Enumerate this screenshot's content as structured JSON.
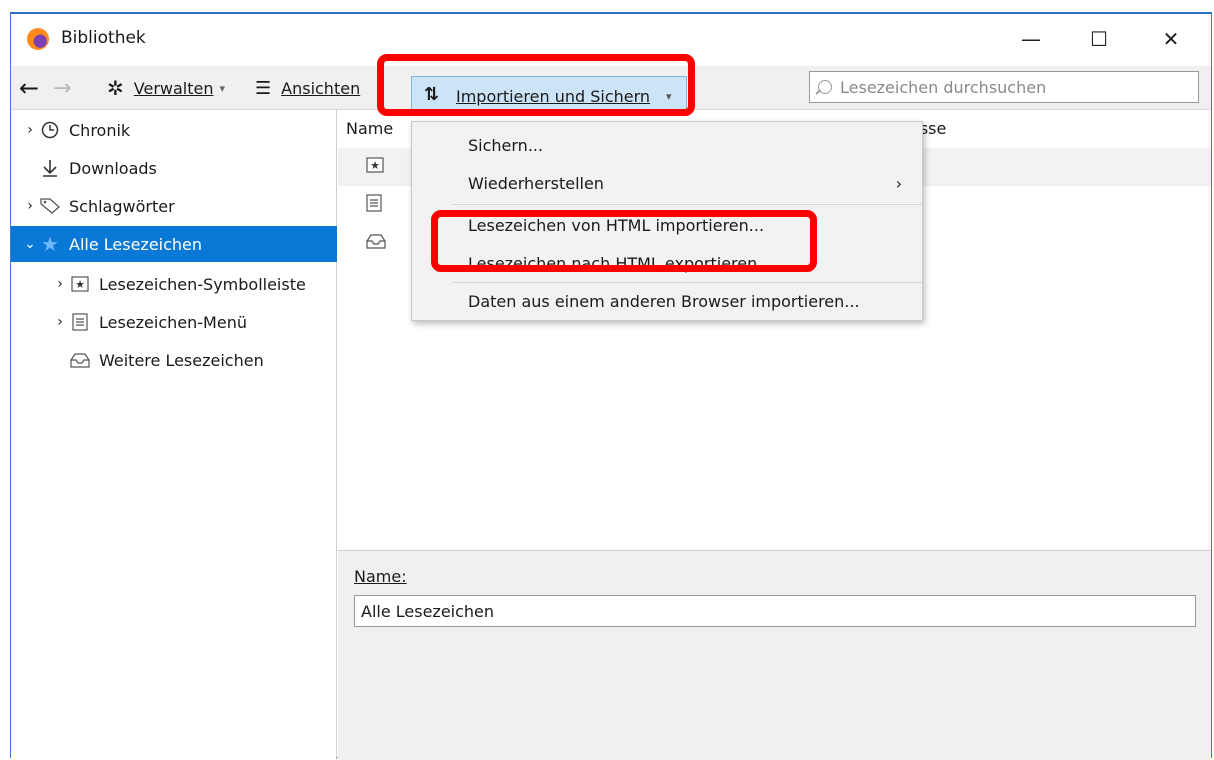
{
  "window": {
    "title": "Bibliothek",
    "buttons": {
      "minimize": "—",
      "maximize": "☐",
      "close": "✕"
    }
  },
  "toolbar": {
    "back": "←",
    "forward": "→",
    "manage_label": "Verwalten",
    "views_label": "Ansichten",
    "import_label": "Importieren und Sichern",
    "dropdown_caret": "▾",
    "search_placeholder": "Lesezeichen durchsuchen"
  },
  "sidebar": {
    "items": [
      {
        "label": "Chronik",
        "icon": "clock-icon",
        "expander": "›"
      },
      {
        "label": "Downloads",
        "icon": "download-icon",
        "expander": ""
      },
      {
        "label": "Schlagwörter",
        "icon": "tag-icon",
        "expander": "›"
      },
      {
        "label": "Alle Lesezeichen",
        "icon": "star-icon",
        "expander": "⌄",
        "selected": true
      },
      {
        "label": "Lesezeichen-Symbolleiste",
        "icon": "bookmark-toolbar-icon",
        "expander": "›"
      },
      {
        "label": "Lesezeichen-Menü",
        "icon": "bookmark-menu-icon",
        "expander": "›"
      },
      {
        "label": "Weitere Lesezeichen",
        "icon": "folder-tray-icon",
        "expander": ""
      }
    ]
  },
  "content": {
    "columns": {
      "name": "Name",
      "address": "esse"
    },
    "rows": [
      {
        "icon": "bookmark-toolbar-icon"
      },
      {
        "icon": "bookmark-menu-icon"
      },
      {
        "icon": "folder-tray-icon"
      }
    ]
  },
  "details": {
    "name_label": "Name:",
    "name_value": "Alle Lesezeichen"
  },
  "menu": {
    "items": [
      {
        "label": "Sichern..."
      },
      {
        "label": "Wiederherstellen",
        "submenu": "›"
      },
      {
        "label": "Lesezeichen von HTML importieren..."
      },
      {
        "label": "Lesezeichen nach HTML exportieren..."
      },
      {
        "label": "Daten aus einem anderen Browser importieren..."
      }
    ]
  },
  "colors": {
    "selection": "#0a78d7",
    "highlight_box": "#ff0000",
    "active_button": "#cce4f7"
  }
}
